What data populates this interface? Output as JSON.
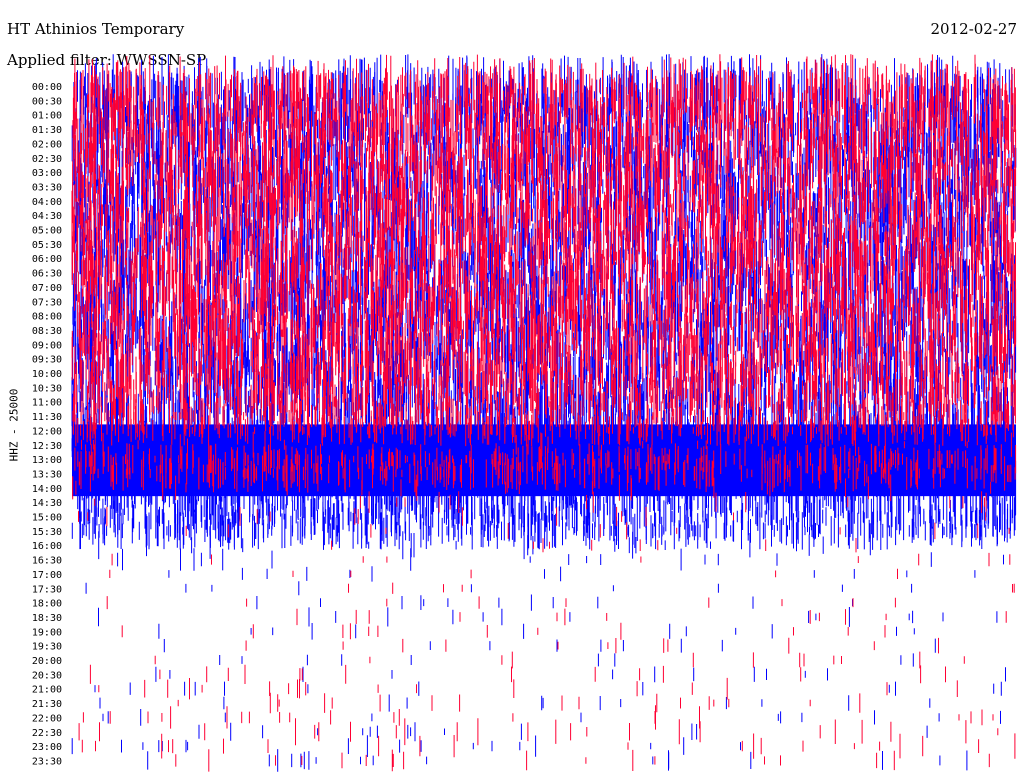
{
  "header": {
    "station": "HT Athinios Temporary",
    "filter": "Applied filter: WWSSN-SP",
    "date": "2012-02-27"
  },
  "colors": {
    "trace_a": "#0000ff",
    "trace_b": "#ff0033",
    "background": "#ffffff"
  },
  "chart_data": {
    "type": "line",
    "title": "HT Athinios Temporary",
    "subtitle": "Applied filter: WWSSN-SP",
    "ylabel": "HHZ - 25000",
    "xlabel": "",
    "categories": [
      "00:00",
      "00:30",
      "01:00",
      "01:30",
      "02:00",
      "02:30",
      "03:00",
      "03:30",
      "04:00",
      "04:30",
      "05:00",
      "05:30",
      "06:00",
      "06:30",
      "07:00",
      "07:30",
      "08:00",
      "08:30",
      "09:00",
      "09:30",
      "10:00",
      "10:30",
      "11:00",
      "11:30",
      "12:00",
      "12:30",
      "13:00",
      "13:30",
      "14:00",
      "14:30",
      "15:00",
      "15:30",
      "16:00",
      "16:30",
      "17:00",
      "17:30",
      "18:00",
      "18:30",
      "19:00",
      "19:30",
      "20:00",
      "20:30",
      "21:00",
      "21:30",
      "22:00",
      "22:30",
      "23:00",
      "23:30"
    ],
    "series": [
      {
        "color": "blue",
        "activity": [
          1.0,
          1.0,
          1.0,
          1.0,
          1.0,
          1.0,
          1.0,
          1.0,
          1.0,
          1.0,
          1.0,
          1.0,
          1.0,
          1.0,
          1.0,
          1.0,
          1.0,
          1.0,
          1.0,
          1.0,
          1.0,
          1.0,
          1.0,
          1.0,
          1.0,
          1.0,
          1.0,
          1.0,
          1.0,
          0.9,
          0.8,
          0.6,
          0.4,
          0.3,
          0.2,
          0.15,
          0.2,
          0.25,
          0.2,
          0.15,
          0.15,
          0.2,
          0.2,
          0.2,
          0.2,
          0.25,
          0.3,
          0.3
        ]
      },
      {
        "color": "red",
        "activity": [
          1.0,
          1.0,
          1.0,
          1.0,
          1.0,
          1.0,
          1.0,
          1.0,
          1.0,
          1.0,
          1.0,
          1.0,
          1.0,
          1.0,
          1.0,
          1.0,
          1.0,
          1.0,
          1.0,
          1.0,
          1.0,
          0.9,
          0.8,
          0.6,
          0.5,
          0.4,
          0.5,
          0.6,
          0.4,
          0.3,
          0.25,
          0.2,
          0.15,
          0.15,
          0.1,
          0.1,
          0.15,
          0.2,
          0.2,
          0.2,
          0.2,
          0.25,
          0.3,
          0.3,
          0.35,
          0.4,
          0.35,
          0.3
        ]
      }
    ],
    "grid": false,
    "legend": "none"
  }
}
